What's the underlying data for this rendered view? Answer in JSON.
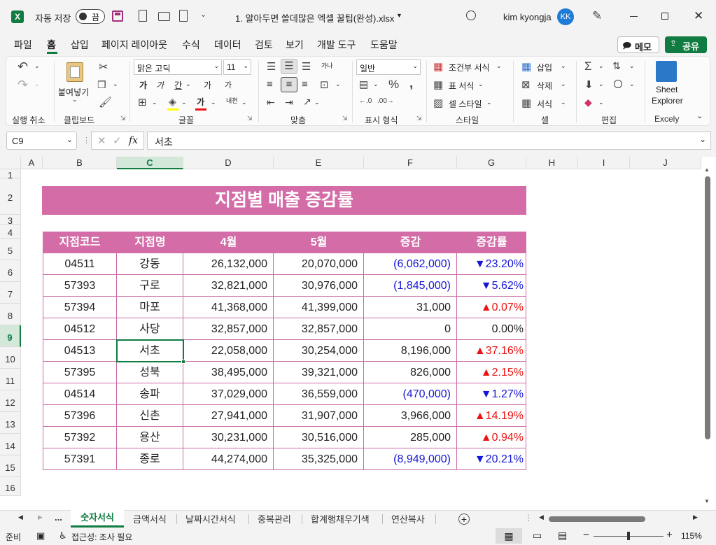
{
  "titlebar": {
    "autosave_label": "자동 저장",
    "autosave_state": "끔",
    "filename": "1. 알아두면 쓸데많은 엑셀 꿀팁(완성).xlsx",
    "user_name": "kim kyongja",
    "user_initials": "KK"
  },
  "menu": {
    "items": [
      "파일",
      "홈",
      "삽입",
      "페이지 레이아웃",
      "수식",
      "데이터",
      "검토",
      "보기",
      "개발 도구",
      "도움말"
    ],
    "memo_label": "메모",
    "share_label": "공유"
  },
  "ribbon": {
    "undo_group": "실행 취소",
    "clipboard": {
      "paste": "붙여넣기",
      "group": "클립보드"
    },
    "font": {
      "name": "맑은 고딕",
      "size": "11",
      "group": "글꼴",
      "bold": "가",
      "italic": "가",
      "underline": "간",
      "grow": "가",
      "shrink": "가",
      "color": "가",
      "phonetic": "내천"
    },
    "align": {
      "group": "맞춤",
      "wrap": "가나"
    },
    "number": {
      "format": "일반",
      "group": "표시 형식"
    },
    "styles": {
      "conditional": "조건부 서식",
      "table": "표 서식",
      "cell": "셀 스타일",
      "group": "스타일"
    },
    "cells": {
      "insert": "삽입",
      "delete": "삭제",
      "format": "서식",
      "group": "셀"
    },
    "edit": {
      "group": "편집"
    },
    "addin": {
      "line1": "Sheet",
      "line2": "Explorer",
      "group": "Excely"
    }
  },
  "formula": {
    "namebox": "C9",
    "fx": "fx",
    "value": "서초"
  },
  "columns": [
    "A",
    "B",
    "C",
    "D",
    "E",
    "F",
    "G",
    "H",
    "I",
    "J"
  ],
  "rows": [
    "1",
    "2",
    "3",
    "4",
    "5",
    "6",
    "7",
    "8",
    "9",
    "10",
    "11",
    "12",
    "13",
    "14",
    "15",
    "16"
  ],
  "sheet": {
    "title": "지점별 매출 증감률",
    "headers": [
      "지점코드",
      "지점명",
      "4월",
      "5월",
      "증감",
      "증감률"
    ],
    "data": [
      {
        "code": "04511",
        "name": "강동",
        "apr": "26,132,000",
        "may": "20,070,000",
        "diff": "(6,062,000)",
        "rate": "▼23.20%",
        "dir": "down"
      },
      {
        "code": "57393",
        "name": "구로",
        "apr": "32,821,000",
        "may": "30,976,000",
        "diff": "(1,845,000)",
        "rate": "▼5.62%",
        "dir": "down"
      },
      {
        "code": "57394",
        "name": "마포",
        "apr": "41,368,000",
        "may": "41,399,000",
        "diff": "31,000",
        "rate": "▲0.07%",
        "dir": "up"
      },
      {
        "code": "04512",
        "name": "사당",
        "apr": "32,857,000",
        "may": "32,857,000",
        "diff": "0",
        "rate": "0.00%",
        "dir": "flat"
      },
      {
        "code": "04513",
        "name": "서초",
        "apr": "22,058,000",
        "may": "30,254,000",
        "diff": "8,196,000",
        "rate": "▲37.16%",
        "dir": "up"
      },
      {
        "code": "57395",
        "name": "성북",
        "apr": "38,495,000",
        "may": "39,321,000",
        "diff": "826,000",
        "rate": "▲2.15%",
        "dir": "up"
      },
      {
        "code": "04514",
        "name": "송파",
        "apr": "37,029,000",
        "may": "36,559,000",
        "diff": "(470,000)",
        "rate": "▼1.27%",
        "dir": "down"
      },
      {
        "code": "57396",
        "name": "신촌",
        "apr": "27,941,000",
        "may": "31,907,000",
        "diff": "3,966,000",
        "rate": "▲14.19%",
        "dir": "up"
      },
      {
        "code": "57392",
        "name": "용산",
        "apr": "30,231,000",
        "may": "30,516,000",
        "diff": "285,000",
        "rate": "▲0.94%",
        "dir": "up"
      },
      {
        "code": "57391",
        "name": "종로",
        "apr": "44,274,000",
        "may": "35,325,000",
        "diff": "(8,949,000)",
        "rate": "▼20.21%",
        "dir": "down"
      }
    ]
  },
  "tabs": {
    "more": "...",
    "items": [
      "숫자서식",
      "금액서식",
      "날짜시간서식",
      "중복관리",
      "합계행채우기색",
      "연산복사"
    ],
    "active": "숫자서식"
  },
  "status": {
    "ready": "준비",
    "accessibility": "접근성: 조사 필요",
    "zoom": "115%"
  },
  "colors": {
    "header": "#d36ca7",
    "title_bg": "#d36ca7",
    "border": "#c96ba4",
    "down": "#1515d6",
    "up": "#e11111",
    "accent": "#107c41"
  }
}
